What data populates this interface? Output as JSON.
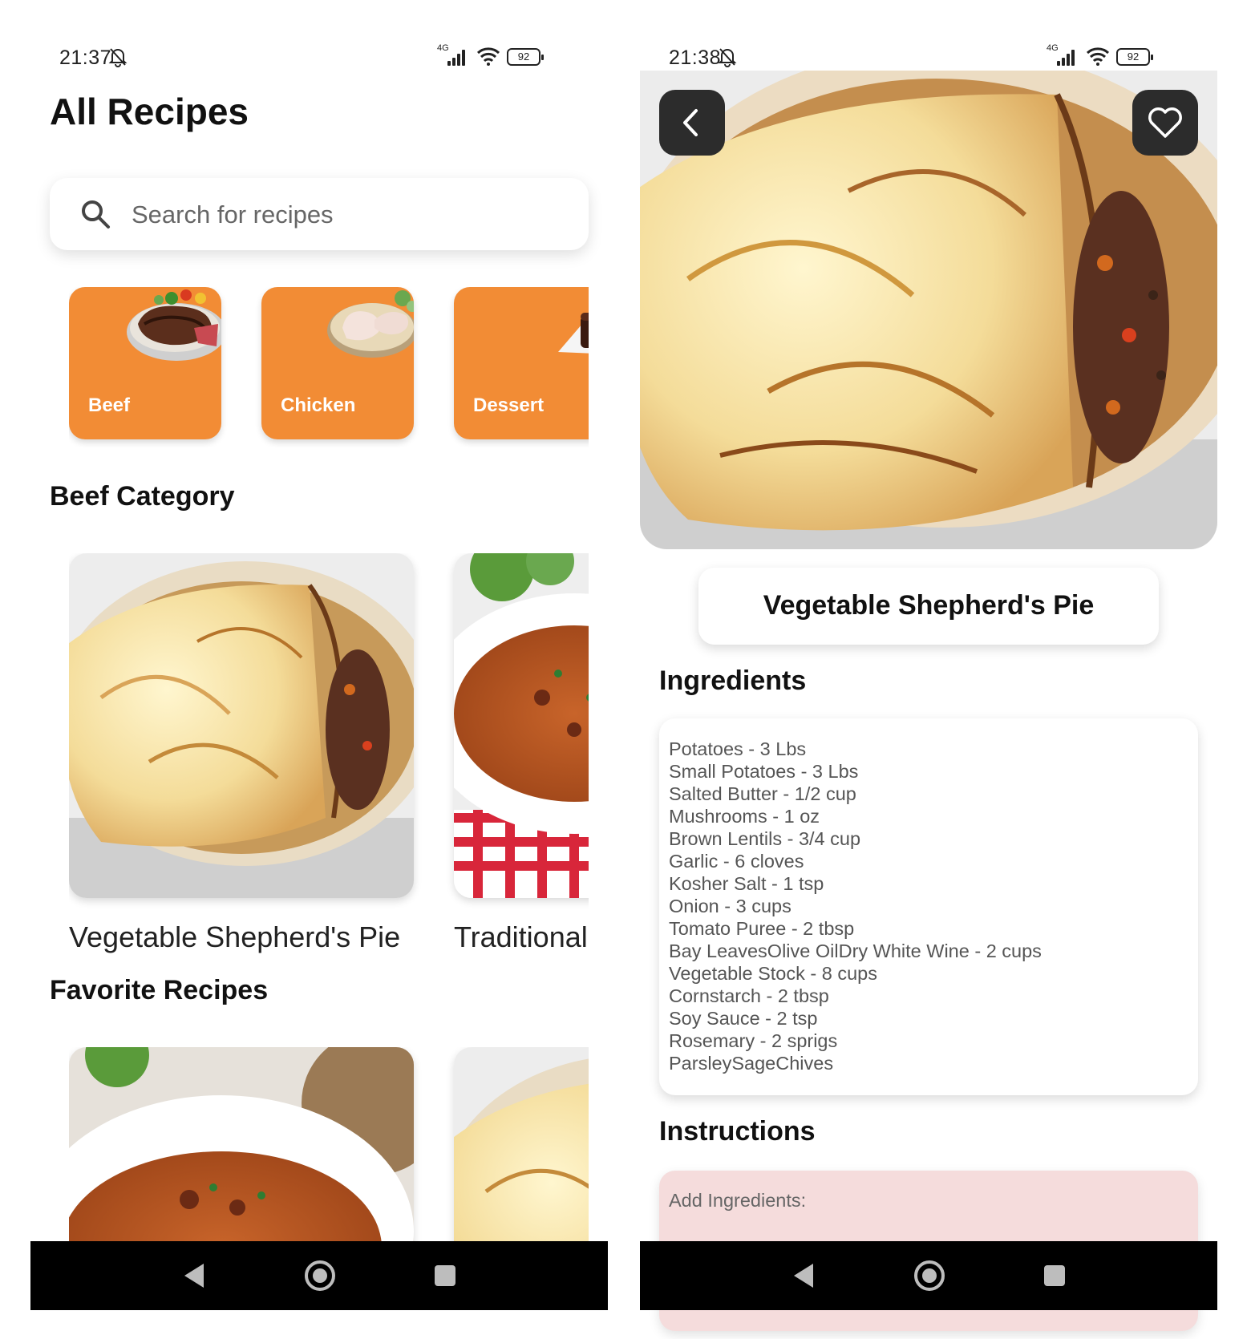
{
  "left_screen": {
    "status": {
      "time": "21:37",
      "network": "4G",
      "battery": "92"
    },
    "title": "All Recipes",
    "search": {
      "placeholder": "Search for recipes"
    },
    "categories": [
      {
        "label": "Beef",
        "icon": "steak-plate-image"
      },
      {
        "label": "Chicken",
        "icon": "chicken-plate-image"
      },
      {
        "label": "Dessert",
        "icon": "chocolate-cake-image"
      }
    ],
    "beef_section": {
      "title": "Beef Category",
      "recipes": [
        {
          "name": "Vegetable Shepherd's Pie",
          "image": "shepherds-pie-image"
        },
        {
          "name": "Traditional",
          "image": "stew-bowl-image"
        }
      ]
    },
    "favorites_section": {
      "title": "Favorite Recipes",
      "recipes": [
        {
          "image": "stew-bowl-image"
        },
        {
          "image": "shepherds-pie-image"
        }
      ]
    }
  },
  "right_screen": {
    "status": {
      "time": "21:38",
      "network": "4G",
      "battery": "92"
    },
    "recipe_title": "Vegetable Shepherd's Pie",
    "ingredients_heading": "Ingredients",
    "ingredients": [
      "Potatoes - 3 Lbs",
      "Small Potatoes - 3 Lbs",
      "Salted Butter - 1/2 cup",
      "Mushrooms - 1 oz",
      "Brown Lentils - 3/4 cup",
      "Garlic - 6 cloves",
      "Kosher Salt - 1 tsp",
      "Onion - 3 cups",
      "Tomato Puree - 2 tbsp",
      "Bay LeavesOlive OilDry White Wine - 2 cups",
      "Vegetable Stock - 8 cups",
      "Cornstarch - 2 tbsp",
      "Soy Sauce - 2 tsp",
      "Rosemary - 2 sprigs",
      "ParsleySageChives"
    ],
    "instructions_heading": "Instructions",
    "instructions_first_line": "Add Ingredients:"
  },
  "colors": {
    "category_orange": "#f28c35",
    "instructions_bg": "#f5dcdc",
    "dark_button": "#2c2c2c",
    "nav_bar": "#000000"
  }
}
